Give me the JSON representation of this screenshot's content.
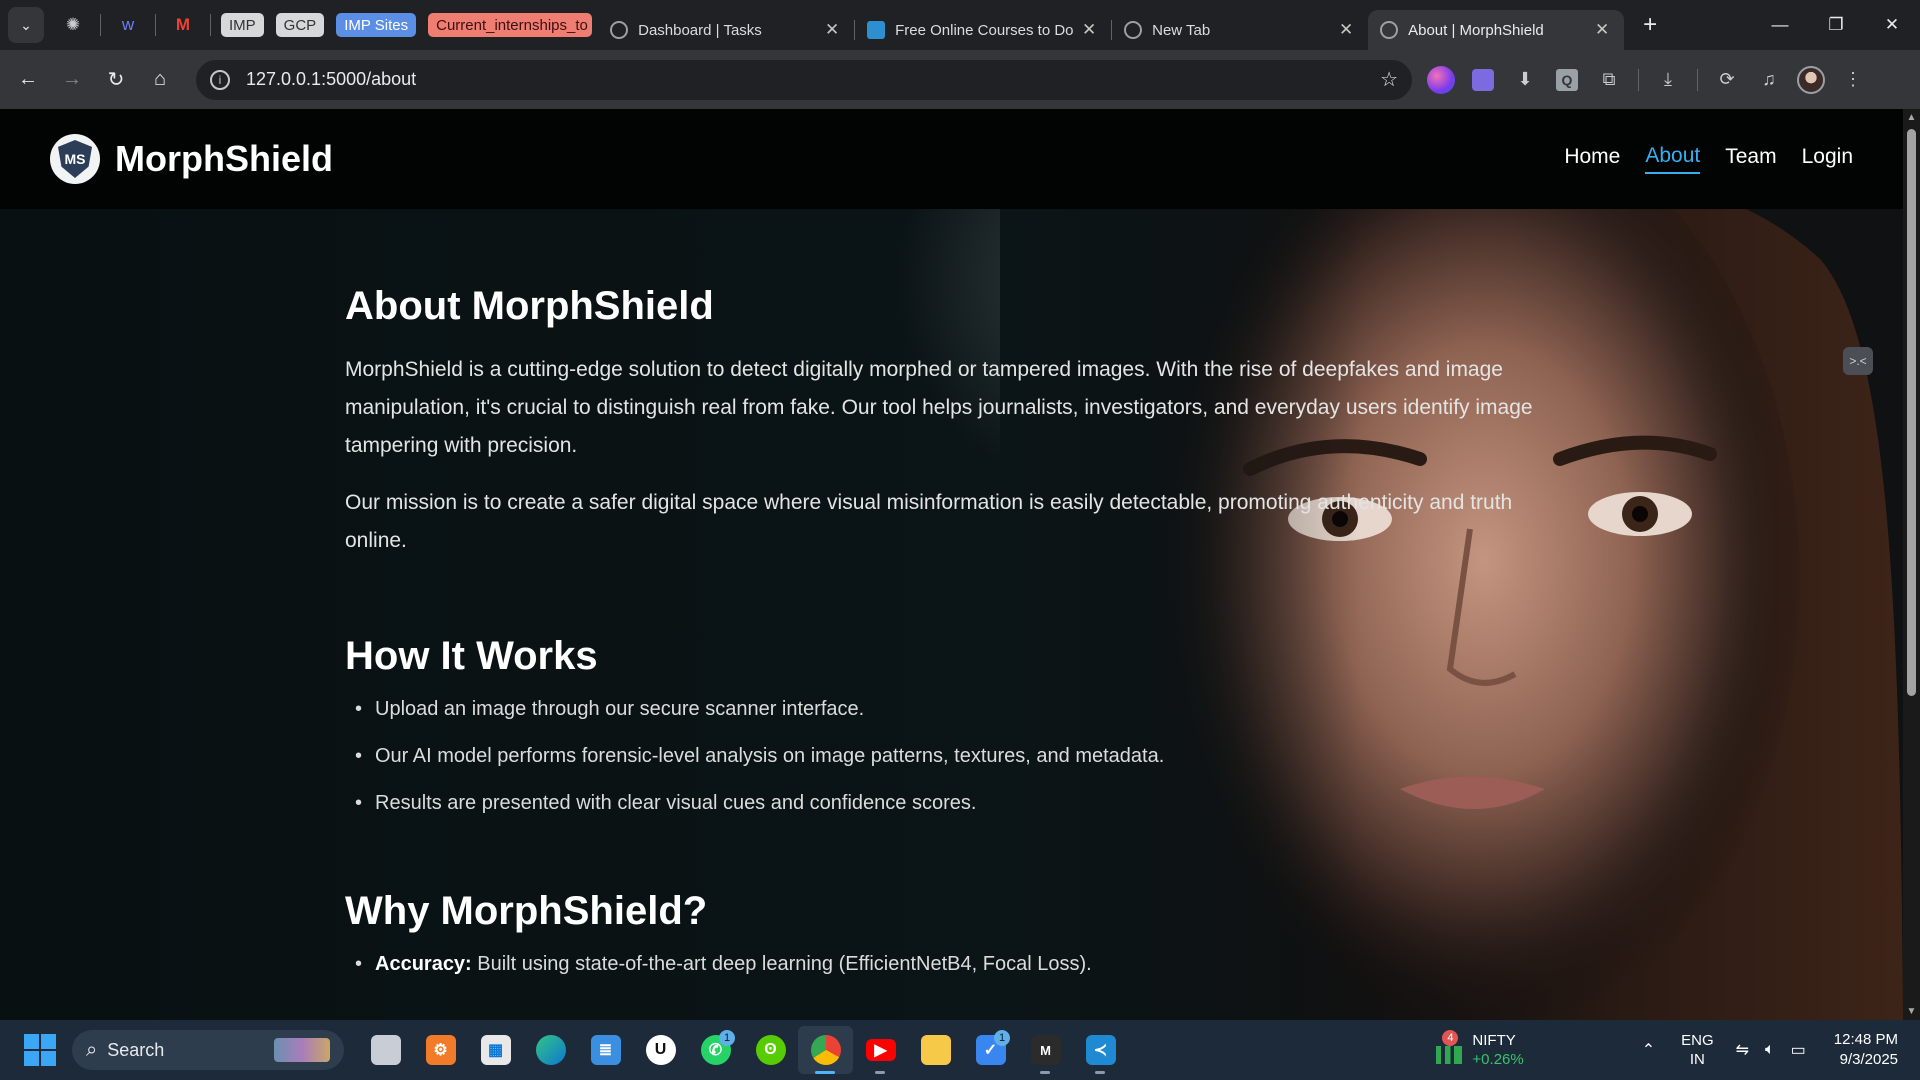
{
  "browser": {
    "bookmarks": [
      "IMP",
      "GCP",
      "IMP Sites",
      "Current_internships_to"
    ],
    "tabs": [
      {
        "title": "Dashboard | Tasks",
        "active": false
      },
      {
        "title": "Free Online Courses to Do",
        "active": false
      },
      {
        "title": "New Tab",
        "active": false
      },
      {
        "title": "About | MorphShield",
        "active": true
      }
    ],
    "url": "127.0.0.1:5000/about",
    "tab_close_glyph": "✕",
    "new_tab_glyph": "+"
  },
  "site": {
    "brand": "MorphShield",
    "logo_text": "MS",
    "nav": [
      "Home",
      "About",
      "Team",
      "Login"
    ],
    "active_nav": "About",
    "accent_color": "#38aef0"
  },
  "about": {
    "title": "About MorphShield",
    "paragraphs": [
      "MorphShield is a cutting-edge solution to detect digitally morphed or tampered images. With the rise of deepfakes and image manipulation, it's crucial to distinguish real from fake. Our tool helps journalists, investigators, and everyday users identify image tampering with precision.",
      "Our mission is to create a safer digital space where visual misinformation is easily detectable, promoting authenticity and truth online."
    ]
  },
  "how": {
    "title": "How It Works",
    "items": [
      "Upload an image through our secure scanner interface.",
      "Our AI model performs forensic-level analysis on image patterns, textures, and metadata.",
      "Results are presented with clear visual cues and confidence scores."
    ]
  },
  "why": {
    "title": "Why MorphShield?",
    "items": [
      {
        "label": "Accuracy:",
        "text": " Built using state-of-the-art deep learning (EfficientNetB4, Focal Loss)."
      }
    ]
  },
  "taskbar": {
    "search_placeholder": "Search",
    "whatsapp_badge": "1",
    "todo_badge": "1",
    "nifty_badge": "4",
    "nifty_label": "NIFTY",
    "nifty_change": "+0.26%",
    "lang_top": "ENG",
    "lang_bottom": "IN",
    "time": "12:48 PM",
    "date": "9/3/2025"
  }
}
